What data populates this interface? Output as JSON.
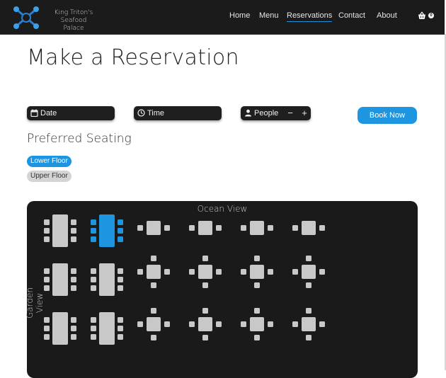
{
  "header": {
    "brand_line1": "King Triton's",
    "brand_line2": "Seafood Palace",
    "nav": [
      {
        "label": "Home",
        "active": false
      },
      {
        "label": "Menu",
        "active": false
      },
      {
        "label": "Reservations",
        "active": true
      },
      {
        "label": "Contact",
        "active": false
      },
      {
        "label": "About",
        "active": false
      }
    ],
    "cart_icon": "basket-icon",
    "cart_count": "0"
  },
  "page": {
    "title": "Make a Reservation"
  },
  "form": {
    "date_label": "Date",
    "time_label": "Time",
    "people_label": "People",
    "minus": "−",
    "plus": "+",
    "book_label": "Book Now"
  },
  "seating": {
    "title": "Preferred Seating",
    "options": [
      "Lower Floor",
      "Upper Floor"
    ],
    "selected": "Lower Floor"
  },
  "floor": {
    "ocean_label": "Ocean View",
    "garden_label": "Garden View",
    "accent": "#1e95e0",
    "table_color": "#c8c8c8",
    "selected_table": "long-1-2"
  }
}
